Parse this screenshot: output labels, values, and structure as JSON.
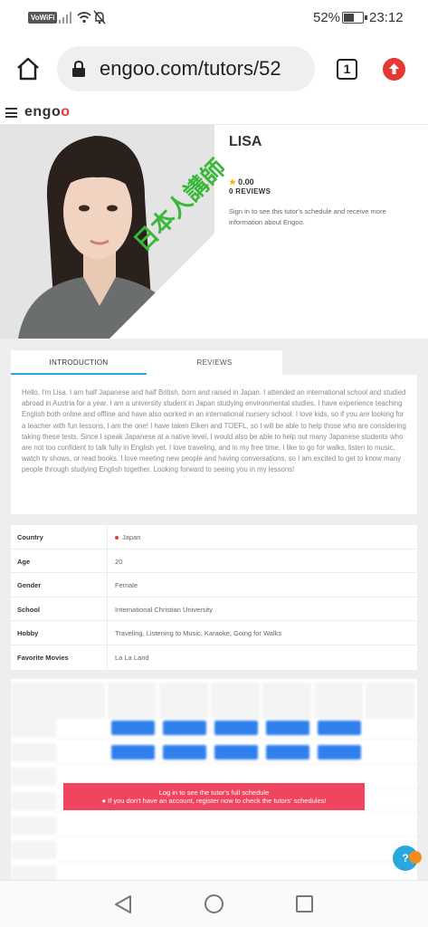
{
  "status_bar": {
    "vowifi": "VoWiFi",
    "battery_pct": "52%",
    "battery_level": 0.52,
    "time": "23:12"
  },
  "browser": {
    "url": "engoo.com/tutors/52",
    "tab_count": "1"
  },
  "site": {
    "logo_text_a": "eng",
    "logo_text_b": "o",
    "logo_text_c": "o"
  },
  "profile": {
    "badge": "日本人講師",
    "name": "LISA",
    "rating": "0.00",
    "reviews": "0 REVIEWS",
    "signin_note": "Sign in to see this tutor's schedule and receive more information about Engoo."
  },
  "tabs": [
    {
      "label": "INTRODUCTION",
      "active": true
    },
    {
      "label": "REVIEWS",
      "active": false
    }
  ],
  "introduction": "Hello, I'm Lisa. I am half Japanese and half British, born and raised in Japan. I attended an international school and studied abroad in Austria for a year. I am a university student in Japan studying environmental studies. I have experience teaching English both online and offline and have also worked in an international nursery school. I love kids, so if you are looking for a teacher with fun lessons, I am the one! I have taken Eiken and TOEFL, so I will be able to help those who are considering taking these tests. Since I speak Japanese at a native level, I would also be able to help out many Japanese students who are not too confident to talk fully in English yet. I love traveling, and in my free time, I like to go for walks, listen to music, watch tv shows, or read books. I love meeting new people and having conversations, so I am excited to get to know many people through studying English together. Looking forward to seeing you in my lessons!",
  "details": [
    {
      "key": "Country",
      "value": "Japan"
    },
    {
      "key": "Age",
      "value": "20"
    },
    {
      "key": "Gender",
      "value": "Female"
    },
    {
      "key": "School",
      "value": "International Christian University"
    },
    {
      "key": "Hobby",
      "value": "Traveling, Listening to Music, Karaoke, Going for Walks"
    },
    {
      "key": "Favorite Movies",
      "value": "La La Land"
    }
  ],
  "schedule": {
    "login_line1": "Log in to see the tutor's full schedule",
    "login_line2": "● If you don't have an account, register now to check the tutors' schedules!",
    "help": "?"
  },
  "colors": {
    "accent_blue": "#29a8e0",
    "slot_blue": "#2f80ed",
    "banner_pink": "#f0455f",
    "badge_green": "#3bb73b",
    "logo_red": "#e53935"
  }
}
